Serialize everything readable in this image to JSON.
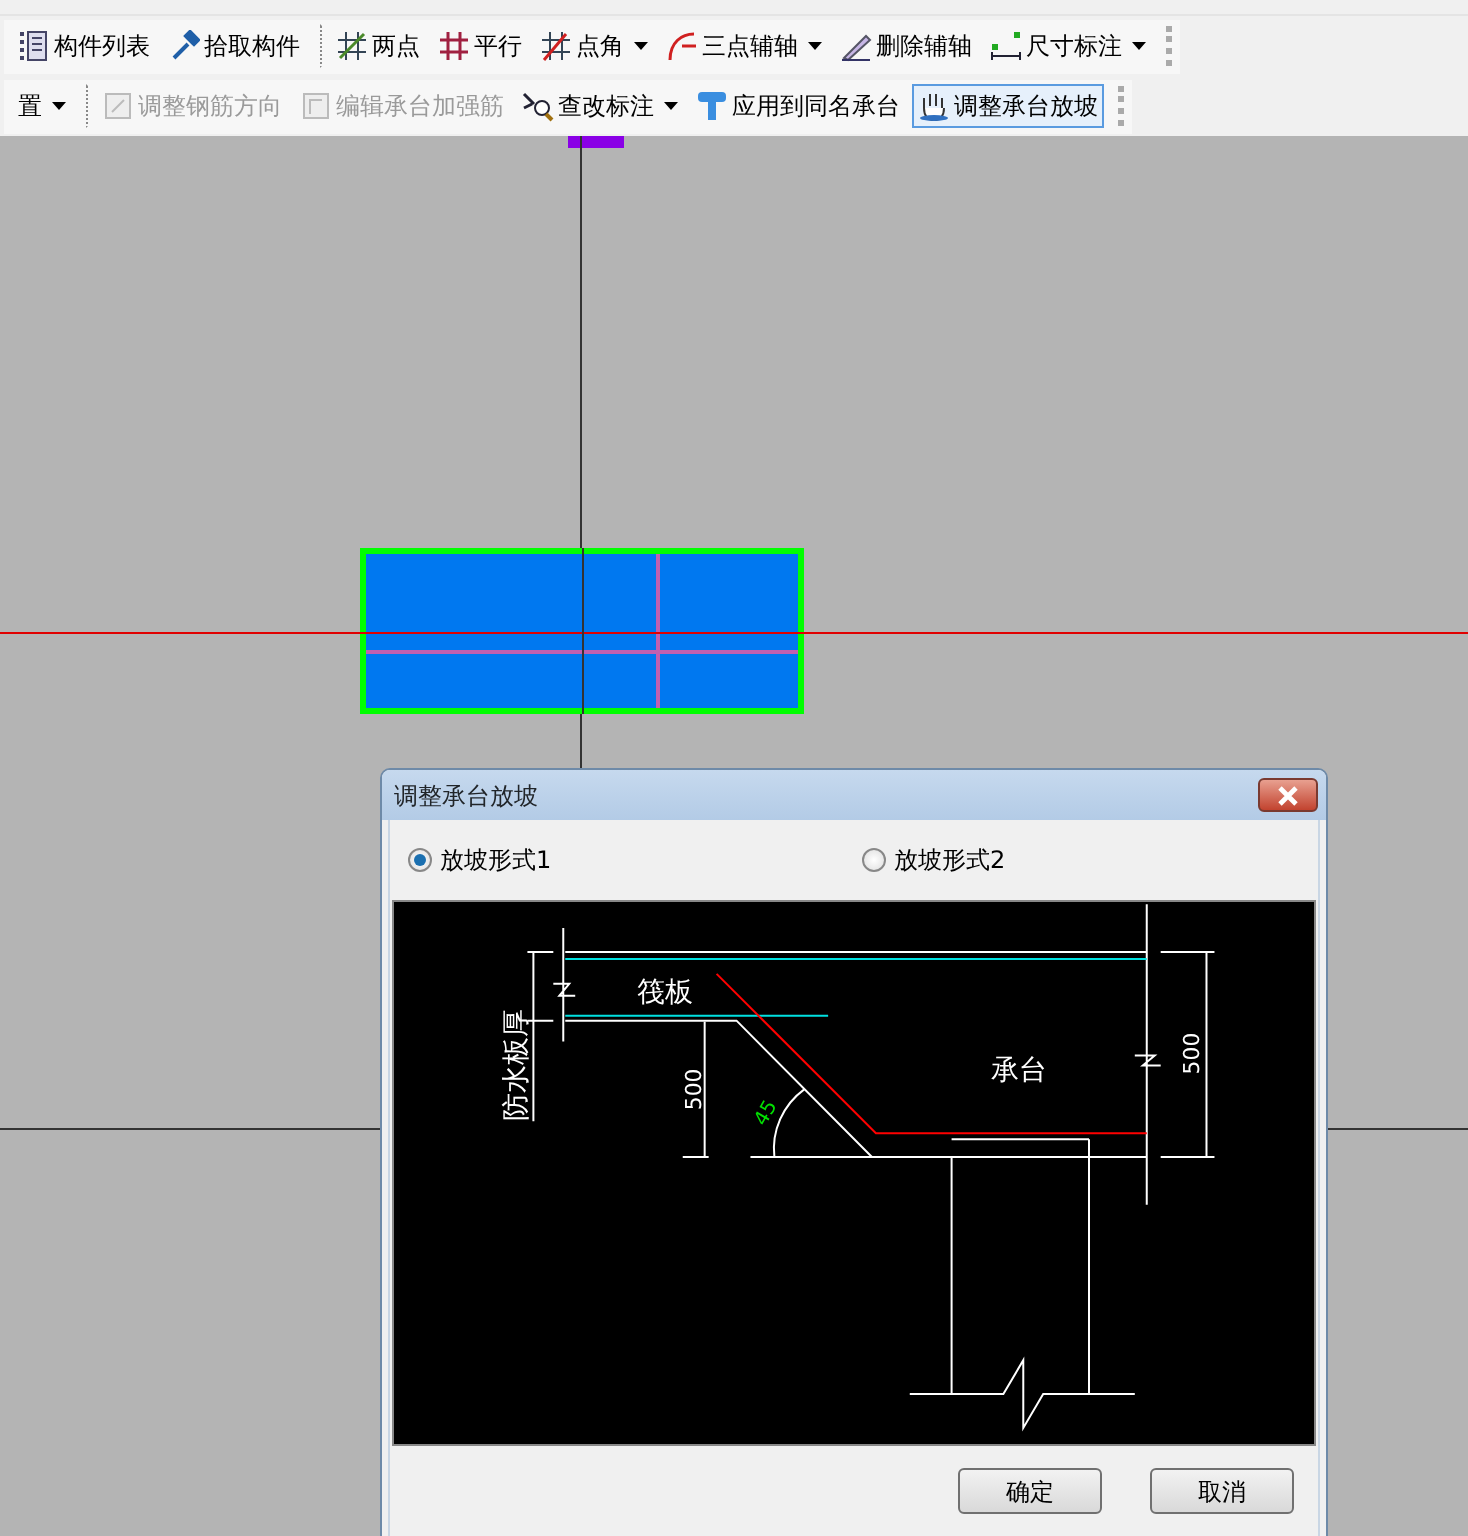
{
  "toolbar_rows": [
    {
      "items": [
        {
          "label": "构件列表",
          "dropdown": false,
          "disabled": false,
          "selected": false,
          "separator_before": false
        },
        {
          "label": "拾取构件",
          "dropdown": false,
          "disabled": false,
          "selected": false,
          "separator_before": false
        },
        {
          "label": "两点",
          "dropdown": false,
          "disabled": false,
          "selected": false,
          "separator_before": true
        },
        {
          "label": "平行",
          "dropdown": false,
          "disabled": false,
          "selected": false,
          "separator_before": false
        },
        {
          "label": "点角",
          "dropdown": true,
          "disabled": false,
          "selected": false,
          "separator_before": false
        },
        {
          "label": "三点辅轴",
          "dropdown": true,
          "disabled": false,
          "selected": false,
          "separator_before": false
        },
        {
          "label": "删除辅轴",
          "dropdown": false,
          "disabled": false,
          "selected": false,
          "separator_before": false
        },
        {
          "label": "尺寸标注",
          "dropdown": true,
          "disabled": false,
          "selected": false,
          "separator_before": false
        }
      ]
    },
    {
      "items": [
        {
          "label": "置",
          "dropdown": true,
          "disabled": false,
          "selected": false,
          "separator_before": false
        },
        {
          "label": "调整钢筋方向",
          "dropdown": false,
          "disabled": true,
          "selected": false,
          "separator_before": true
        },
        {
          "label": "编辑承台加强筋",
          "dropdown": false,
          "disabled": true,
          "selected": false,
          "separator_before": false
        },
        {
          "label": "查改标注",
          "dropdown": true,
          "disabled": false,
          "selected": false,
          "separator_before": false
        },
        {
          "label": "应用到同名承台",
          "dropdown": false,
          "disabled": false,
          "selected": false,
          "separator_before": false
        },
        {
          "label": "调整承台放坡",
          "dropdown": false,
          "disabled": false,
          "selected": true,
          "separator_before": false
        }
      ]
    }
  ],
  "dialog": {
    "title": "调整承台放坡",
    "options": [
      {
        "label": "放坡形式1",
        "selected": true
      },
      {
        "label": "放坡形式2",
        "selected": false
      }
    ],
    "drawing": {
      "labels": [
        "筏板",
        "防水板厚",
        "500",
        "45",
        "承台",
        "500"
      ]
    },
    "buttons": [
      "确定",
      "取消"
    ]
  }
}
